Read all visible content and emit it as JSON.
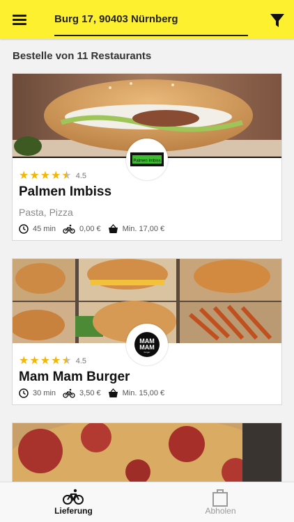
{
  "header": {
    "address": "Burg 17, 90403 Nürnberg",
    "menu_icon": "menu-icon",
    "filter_icon": "filter-icon",
    "background_color": "#fdf02e"
  },
  "list": {
    "title": "Bestelle von 11 Restaurants"
  },
  "restaurants": [
    {
      "name": "Palmen Imbiss",
      "rating": "4.5",
      "rating_value": 4.5,
      "cuisine": "Pasta, Pizza",
      "delivery_time": "45 min",
      "delivery_fee": "0,00 €",
      "min_order": "Min. 17,00 €",
      "logo_text": "Palmen Imbiss"
    },
    {
      "name": "Mam Mam Burger",
      "rating": "4.5",
      "rating_value": 4.5,
      "cuisine": "",
      "delivery_time": "30 min",
      "delivery_fee": "3,50 €",
      "min_order": "Min. 15,00 €",
      "logo_text_line1": "MAM",
      "logo_text_line2": "MAM",
      "logo_subtext": "burger"
    }
  ],
  "bottom_nav": {
    "delivery_label": "Lieferung",
    "pickup_label": "Abholen",
    "active": "Lieferung"
  },
  "colors": {
    "star": "#f2b705",
    "accent": "#fdf02e"
  }
}
